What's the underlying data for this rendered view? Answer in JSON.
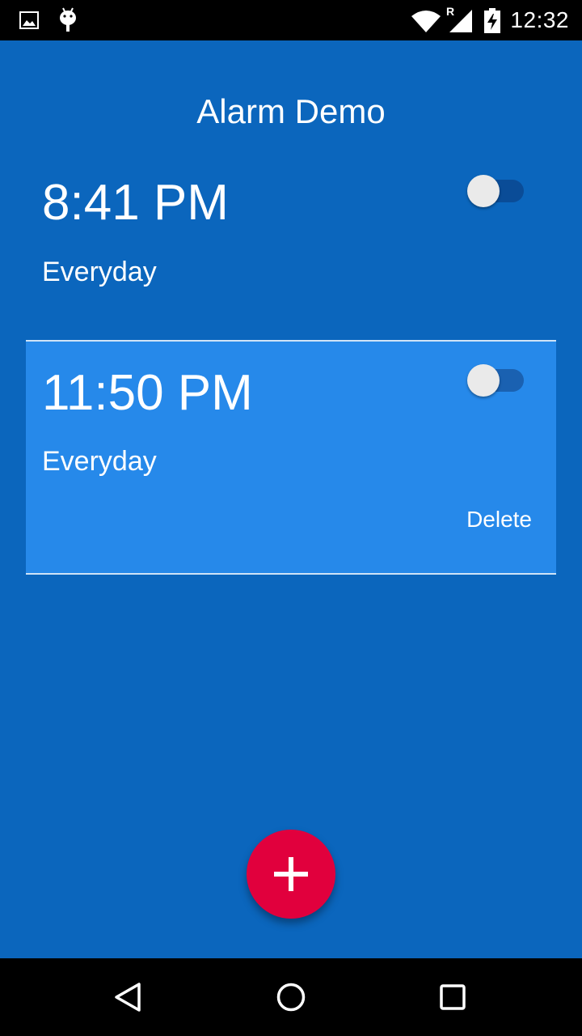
{
  "status_bar": {
    "time": "12:32",
    "icons": [
      "image-icon",
      "android-debug-icon",
      "wifi-icon",
      "signal-icon",
      "battery-charging-icon"
    ],
    "roaming_indicator": "R"
  },
  "app": {
    "title": "Alarm Demo",
    "background_color": "#0b66bd",
    "selected_card_color": "#2689ea"
  },
  "alarms": [
    {
      "time": "8:41 PM",
      "repeat": "Everyday",
      "enabled": false,
      "selected": false
    },
    {
      "time": "11:50 PM",
      "repeat": "Everyday",
      "enabled": false,
      "selected": true,
      "delete_label": "Delete"
    }
  ],
  "fab": {
    "icon": "plus-icon",
    "color": "#e1003d"
  },
  "nav_bar": {
    "buttons": [
      "back-icon",
      "home-icon",
      "recents-icon"
    ]
  }
}
